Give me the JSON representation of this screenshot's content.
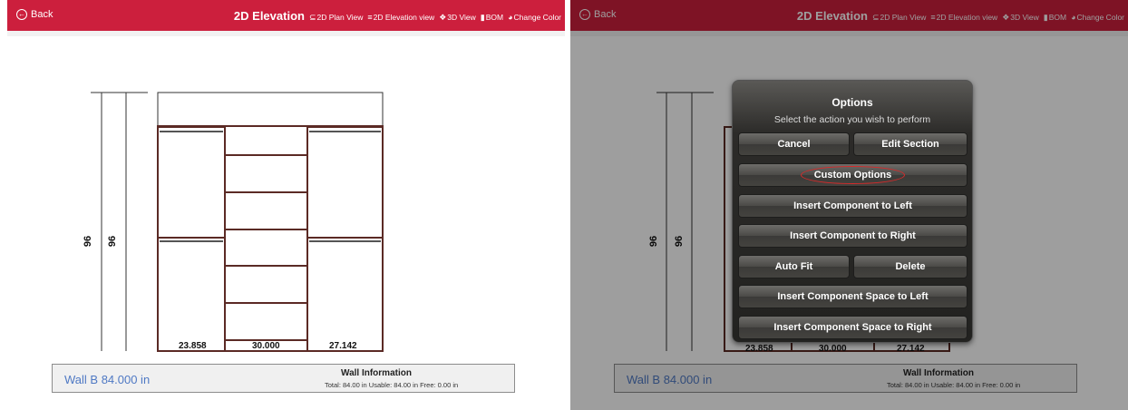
{
  "toolbar": {
    "back_label": "Back",
    "title": "2D Elevation",
    "items": [
      {
        "icon": "plan-view-icon",
        "glyph": "⊆",
        "label": "2D Plan View"
      },
      {
        "icon": "elevation-view-icon",
        "glyph": "≡",
        "label": "2D Elevation view"
      },
      {
        "icon": "cube-icon",
        "glyph": "❖",
        "label": "3D View"
      },
      {
        "icon": "document-icon",
        "glyph": "▮",
        "label": "BOM"
      },
      {
        "icon": "palette-icon",
        "glyph": "◕",
        "label": "Change Color"
      }
    ]
  },
  "elevation": {
    "height_labels": [
      "96",
      "96"
    ],
    "section_widths": [
      "23.858",
      "30.000",
      "27.142"
    ]
  },
  "wall": {
    "name": "Wall B 84.000 in",
    "info_title": "Wall Information",
    "info_stats": "Total: 84.00 in   Usable: 84.00 in    Free: 0.00 in"
  },
  "dialog": {
    "title": "Options",
    "subtitle": "Select the action you wish to perform",
    "cancel": "Cancel",
    "edit_section": "Edit Section",
    "custom_options": "Custom Options",
    "insert_left": "Insert Component to Left",
    "insert_right": "Insert Component to Right",
    "auto_fit": "Auto Fit",
    "delete": "Delete",
    "insert_space_left": "Insert Component Space to Left",
    "insert_space_right": "Insert Component Space to Right"
  },
  "colors": {
    "toolbar": "#cc1f3d",
    "panel_line": "#5b2a25",
    "wall_name": "#4f79c4",
    "highlight": "#d82a2a"
  }
}
